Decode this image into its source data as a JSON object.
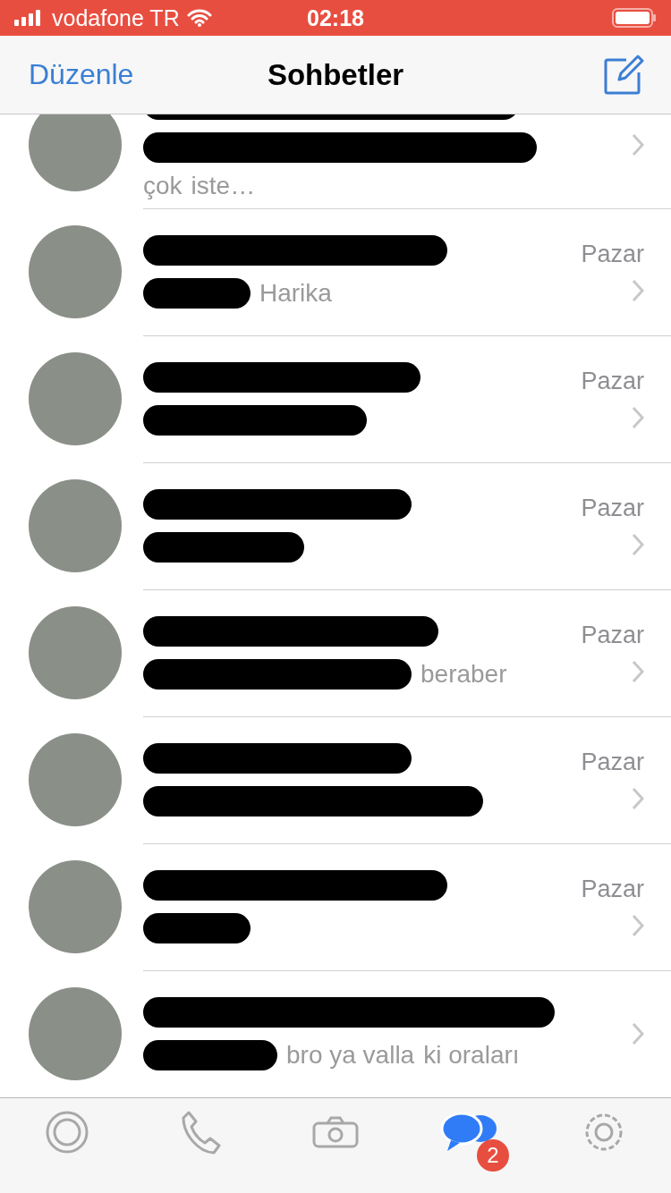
{
  "status_bar": {
    "carrier": "vodafone TR",
    "time": "02:18"
  },
  "nav_bar": {
    "left_button": "Düzenle",
    "title": "Sohbetler"
  },
  "chats": [
    {
      "fragments": [
        "çok",
        "iste…"
      ]
    },
    {
      "time": "Pazar",
      "fragments": [
        "Harika"
      ]
    },
    {
      "time": "Pazar"
    },
    {
      "time": "Pazar"
    },
    {
      "time": "Pazar",
      "fragments": [
        "beraber"
      ]
    },
    {
      "time": "Pazar"
    },
    {
      "time": "Pazar"
    },
    {
      "fragments": [
        "bro ya valla",
        "ki oraları"
      ]
    }
  ],
  "tab_bar": [
    {
      "kind": "status",
      "selected": false
    },
    {
      "kind": "calls",
      "selected": false
    },
    {
      "kind": "camera",
      "selected": false
    },
    {
      "kind": "chats",
      "selected": true,
      "badge": "2"
    },
    {
      "kind": "settings",
      "selected": false
    }
  ]
}
